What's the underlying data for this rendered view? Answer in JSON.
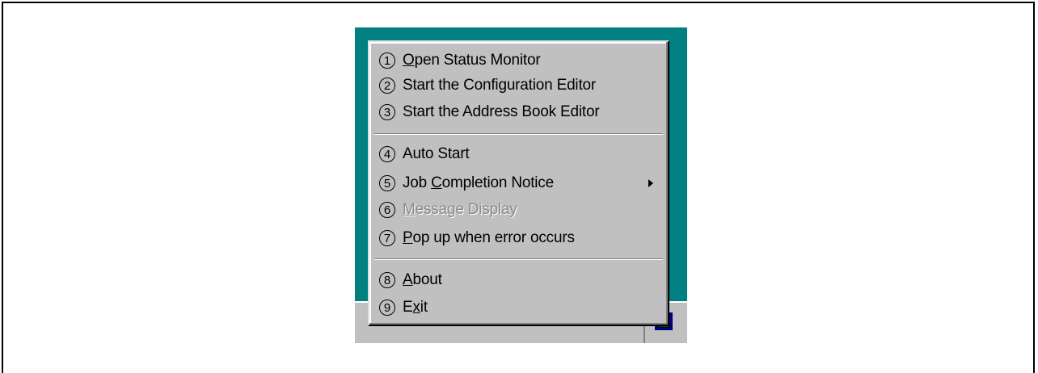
{
  "menu": {
    "items": [
      {
        "num": "1",
        "pre": "",
        "u": "O",
        "post": "pen Status Monitor"
      },
      {
        "num": "2",
        "pre": "Start the Configuration Editor",
        "u": "",
        "post": ""
      },
      {
        "num": "3",
        "pre": "Start the Address Book Editor",
        "u": "",
        "post": ""
      },
      {
        "num": "4",
        "pre": "Auto Start",
        "u": "",
        "post": ""
      },
      {
        "num": "5",
        "pre": "Job ",
        "u": "C",
        "post": "ompletion Notice"
      },
      {
        "num": "6",
        "pre": "",
        "u": "M",
        "post": "essage Display"
      },
      {
        "num": "7",
        "pre": "",
        "u": "P",
        "post": "op up when error occurs"
      },
      {
        "num": "8",
        "pre": "",
        "u": "A",
        "post": "bout"
      },
      {
        "num": "9",
        "pre": "E",
        "u": "x",
        "post": "it"
      }
    ]
  },
  "colors": {
    "desktop": "#008080",
    "menu_bg": "#c0c0c0",
    "disabled_text": "#8a8a8a"
  },
  "icons": {
    "submenu": "chevron-right-icon",
    "tray": "status-monitor-tray-icon"
  }
}
